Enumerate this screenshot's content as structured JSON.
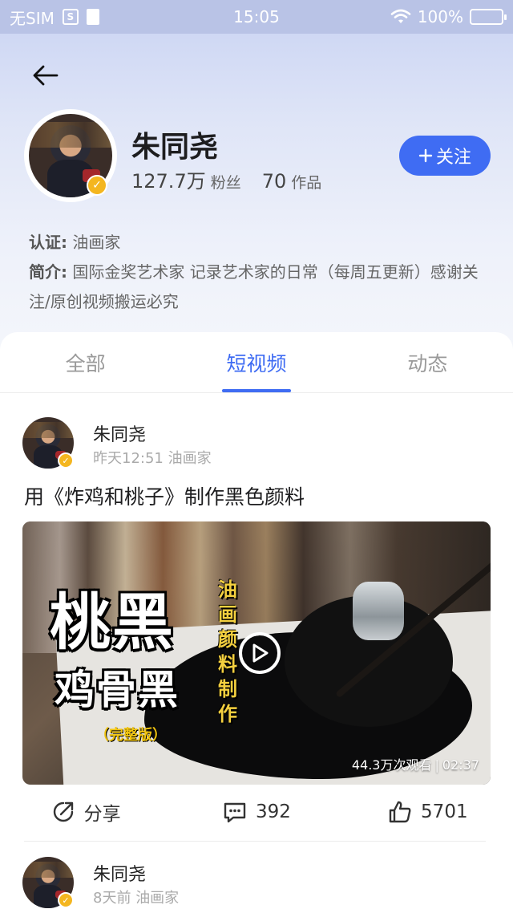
{
  "status_bar": {
    "carrier": "无SIM",
    "time": "15:05",
    "battery": "100%"
  },
  "profile": {
    "name": "朱同尧",
    "fans_count": "127.7万",
    "fans_label": "粉丝",
    "works_count": "70",
    "works_label": "作品",
    "follow_label": "关注",
    "cert_key": "认证:",
    "cert_value": "油画家",
    "intro_key": "简介:",
    "intro_value": "国际金奖艺术家 记录艺术家的日常（每周五更新）感谢关注/原创视频搬运必究"
  },
  "tabs": [
    {
      "label": "全部"
    },
    {
      "label": "短视频"
    },
    {
      "label": "动态"
    }
  ],
  "posts": [
    {
      "author": "朱同尧",
      "time": "昨天12:51",
      "tag": "油画家",
      "title": "用《炸鸡和桃子》制作黑色颜料",
      "cover_big": "桃黑",
      "cover_mid": "鸡骨黑",
      "cover_small": "（完整版）",
      "cover_vertical": "油画颜料制作",
      "views": "44.3万次观看",
      "duration": "02:37",
      "share_label": "分享",
      "comments": "392",
      "likes": "5701"
    },
    {
      "author": "朱同尧",
      "time": "8天前",
      "tag": "油画家"
    }
  ],
  "colors": {
    "accent": "#3f6cf3",
    "badge": "#f4b620"
  },
  "icons": [
    "back-arrow-icon",
    "wifi-icon",
    "battery-icon",
    "verified-badge-icon",
    "plus-icon",
    "share-icon",
    "comment-icon",
    "like-icon",
    "play-icon"
  ]
}
